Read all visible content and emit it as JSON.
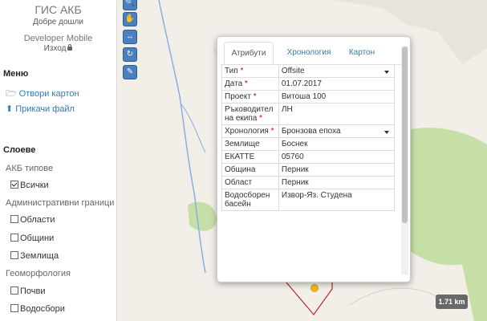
{
  "sidebar": {
    "app_title": "ГИС АКБ",
    "greeting": "Добре дошли",
    "user": "Developer Mobile",
    "logout": "Изход",
    "menu_title": "Меню",
    "menu_items": [
      {
        "label": "Отвори картон",
        "icon": "folder-open-icon"
      },
      {
        "label": "Прикачи файл",
        "icon": "upload-icon"
      }
    ],
    "layers_title": "Слоеве",
    "layer_groups": [
      {
        "label": "АКБ типове",
        "items": [
          {
            "label": "Всички",
            "checked": true
          }
        ]
      },
      {
        "label": "Административни граници",
        "items": [
          {
            "label": "Области",
            "checked": false
          },
          {
            "label": "Общини",
            "checked": false
          },
          {
            "label": "Землища",
            "checked": false
          }
        ]
      },
      {
        "label": "Геоморфология",
        "items": [
          {
            "label": "Почви",
            "checked": false
          },
          {
            "label": "Водосбори",
            "checked": false
          }
        ]
      }
    ]
  },
  "toolbar": {
    "buttons": [
      {
        "name": "zoom-icon"
      },
      {
        "name": "pan-hand-icon"
      },
      {
        "name": "measure-icon"
      },
      {
        "name": "refresh-icon"
      },
      {
        "name": "edit-pencil-icon"
      }
    ]
  },
  "popup": {
    "tabs": [
      {
        "label": "Атрибути",
        "active": true
      },
      {
        "label": "Хронология",
        "active": false
      },
      {
        "label": "Картон",
        "active": false
      }
    ],
    "rows": [
      {
        "label": "Тип",
        "required": true,
        "value": "Offsite",
        "select": true
      },
      {
        "label": "Дата",
        "required": true,
        "value": "01.07.2017",
        "select": false
      },
      {
        "label": "Проект",
        "required": true,
        "value": "Витоша 100",
        "select": false
      },
      {
        "label": "Ръководител на екипа",
        "required": true,
        "value": "ЛН",
        "select": false
      },
      {
        "label": "Хронология",
        "required": true,
        "value": "Бронзова епоха",
        "select": true
      },
      {
        "label": "Землище",
        "required": false,
        "value": "Боснек",
        "select": false
      },
      {
        "label": "ЕКАТТЕ",
        "required": false,
        "value": "05760",
        "select": false
      },
      {
        "label": "Община",
        "required": false,
        "value": "Перник",
        "select": false
      },
      {
        "label": "Област",
        "required": false,
        "value": "Перник",
        "select": false
      },
      {
        "label": "Водосборен басейн",
        "required": false,
        "value": "Извор-Яз. Студена",
        "select": false
      }
    ]
  },
  "map": {
    "scale": "1.71 km"
  },
  "colors": {
    "link": "#337ab7",
    "map_bg": "#f2efe9",
    "forest": "#c6dfa6",
    "polygon": "#b8272b",
    "marker": "#f3b726"
  }
}
